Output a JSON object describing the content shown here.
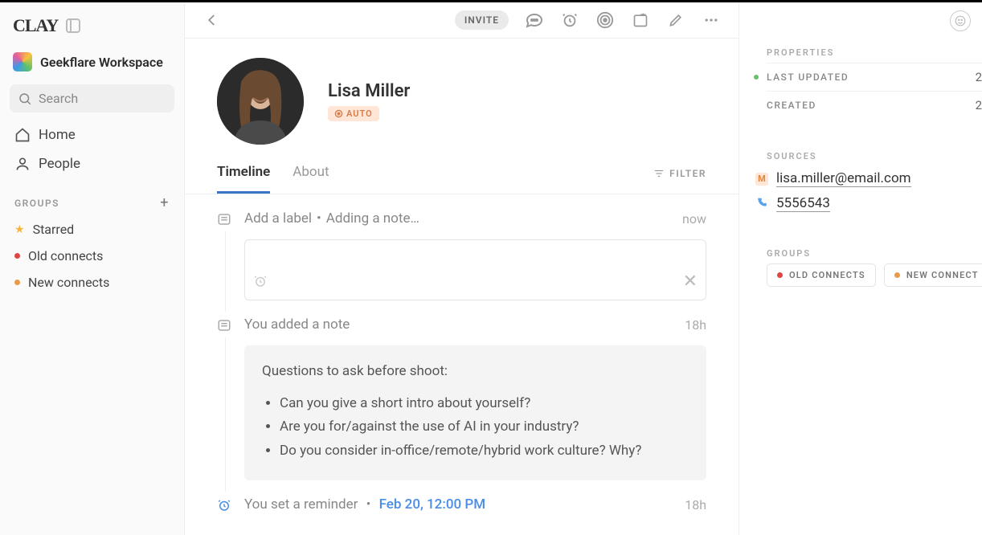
{
  "brand": "CLAY",
  "workspace": "Geekflare Workspace",
  "sidebar": {
    "search_placeholder": "Search",
    "home_label": "Home",
    "people_label": "People",
    "groups_header": "GROUPS",
    "groups": [
      {
        "label": "Starred"
      },
      {
        "label": "Old connects"
      },
      {
        "label": "New connects"
      }
    ]
  },
  "toolbar": {
    "invite": "INVITE"
  },
  "profile": {
    "name": "Lisa Miller",
    "badge": "AUTO"
  },
  "tabs": {
    "timeline": "Timeline",
    "about": "About",
    "filter": "FILTER"
  },
  "timeline": {
    "add_label": "Add a label",
    "adding_note": "Adding a note…",
    "now": "now",
    "added_note": "You added a note",
    "added_note_time": "18h",
    "note": {
      "heading": "Questions to ask before shoot:",
      "items": [
        "Can you give a short intro about yourself?",
        "Are you for/against the use of AI in your industry?",
        "Do you consider in-office/remote/hybrid work culture? Why?"
      ]
    },
    "reminder_prefix": "You set a reminder",
    "reminder_date": "Feb 20, 12:00 PM",
    "reminder_time": "18h"
  },
  "right": {
    "properties_hd": "PROPERTIES",
    "last_updated": "LAST UPDATED",
    "last_updated_val": "2",
    "created": "CREATED",
    "created_val": "2",
    "sources_hd": "SOURCES",
    "email": "lisa.miller@email.com",
    "phone": "5556543",
    "groups_hd": "GROUPS",
    "chip_old": "OLD CONNECTS",
    "chip_new": "NEW CONNECT"
  }
}
